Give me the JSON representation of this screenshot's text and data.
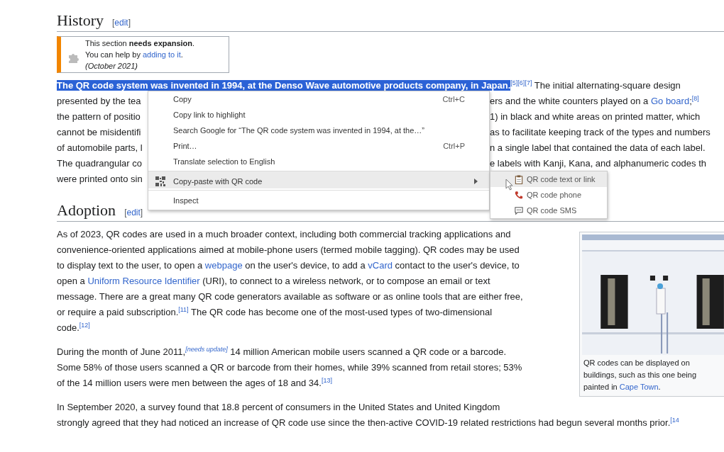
{
  "history": {
    "heading": "History",
    "edit_link": [
      "[",
      "edit",
      "]"
    ],
    "notice": {
      "lines": [
        [
          {
            "kind": "text",
            "text": "This section "
          },
          {
            "kind": "bold",
            "text": "needs expansion"
          },
          {
            "kind": "text",
            "text": "."
          }
        ],
        [
          {
            "kind": "text",
            "text": "You can help by "
          },
          {
            "kind": "link",
            "text": "adding to it"
          },
          {
            "kind": "text",
            "text": "."
          }
        ],
        [
          {
            "kind": "italic",
            "text": "(October 2021)"
          }
        ]
      ]
    },
    "paragraph": [
      {
        "left": [
          {
            "kind": "selected",
            "text": "The QR code system was invented in 1994, at the Denso Wave automotive products company, in Japan."
          },
          {
            "kind": "ref",
            "text": "[5]"
          },
          {
            "kind": "ref",
            "text": "[6]"
          },
          {
            "kind": "ref",
            "text": "[7]"
          },
          {
            "kind": "text",
            "text": " The initial alternating-square design"
          }
        ]
      },
      {
        "left": [
          {
            "kind": "text",
            "text": "presented by the tea"
          }
        ],
        "right": [
          {
            "kind": "text",
            "text": "ers and the white counters played on a "
          },
          {
            "kind": "link",
            "text": "Go board"
          },
          {
            "kind": "text",
            "text": ";"
          },
          {
            "kind": "ref",
            "text": "[8]"
          }
        ]
      },
      {
        "left": [
          {
            "kind": "text",
            "text": "the pattern of positio"
          }
        ],
        "right": [
          {
            "kind": "text",
            "text": "1) in black and white areas on printed matter, which"
          }
        ]
      },
      {
        "left": [
          {
            "kind": "text",
            "text": "cannot be misidentifi"
          }
        ],
        "right": [
          {
            "kind": "text",
            "text": "as to facilitate keeping track of the types and numbers"
          }
        ]
      },
      {
        "left": [
          {
            "kind": "text",
            "text": "of automobile parts, l"
          }
        ],
        "right": [
          {
            "kind": "text",
            "text": "n a single label that contained the data of each label."
          }
        ]
      },
      {
        "left": [
          {
            "kind": "text",
            "text": "The quadrangular co"
          }
        ],
        "right": [
          {
            "kind": "text",
            "text": "e labels with Kanji, Kana, and alphanumeric codes th"
          }
        ]
      },
      {
        "left": [
          {
            "kind": "text",
            "text": "were printed onto sin"
          }
        ]
      }
    ]
  },
  "context_menu": {
    "items": [
      {
        "label": "Copy",
        "shortcut": "Ctrl+C",
        "selected": false,
        "separator_before": false,
        "submenu": false
      },
      {
        "label": "Copy link to highlight",
        "selected": false,
        "separator_before": false,
        "submenu": false
      },
      {
        "label": "Search Google for “The QR code system was invented in 1994, at the…”",
        "selected": false,
        "separator_before": false,
        "submenu": false
      },
      {
        "label": "Print…",
        "shortcut": "Ctrl+P",
        "selected": false,
        "separator_before": false,
        "submenu": false
      },
      {
        "label": "Translate selection to English",
        "selected": false,
        "separator_before": false,
        "submenu": false
      },
      {
        "label": "Copy-paste with QR code",
        "selected": true,
        "separator_before": true,
        "submenu": true
      },
      {
        "label": "Inspect",
        "selected": false,
        "separator_before": true,
        "submenu": false
      }
    ],
    "submenu": [
      {
        "label": "QR code text or link",
        "selected": true
      },
      {
        "label": "QR code phone",
        "selected": false
      },
      {
        "label": "QR code SMS",
        "selected": false
      }
    ]
  },
  "adoption": {
    "heading": "Adoption",
    "edit_link": [
      "[",
      "edit",
      "]"
    ],
    "figure": {
      "kind": "picture",
      "caption": [
        [
          {
            "kind": "text",
            "text": "QR codes can be displayed on"
          }
        ],
        [
          {
            "kind": "text",
            "text": "buildings, such as this one being"
          }
        ],
        [
          {
            "kind": "text",
            "text": "painted in "
          },
          {
            "kind": "link",
            "text": "Cape Town"
          },
          {
            "kind": "text",
            "text": "."
          }
        ]
      ]
    },
    "paragraphs": [
      [
        [
          {
            "kind": "text",
            "text": "As of 2023, QR codes are used in a much broader context, including both commercial tracking applications and"
          }
        ],
        [
          {
            "kind": "text",
            "text": "convenience-oriented applications aimed at mobile-phone users (termed mobile tagging). QR codes may be used"
          }
        ],
        [
          {
            "kind": "text",
            "text": "to display text to the user, to open a "
          },
          {
            "kind": "link",
            "text": "webpage"
          },
          {
            "kind": "text",
            "text": " on the user's device, to add a "
          },
          {
            "kind": "link",
            "text": "vCard"
          },
          {
            "kind": "text",
            "text": " contact to the user's device, to"
          }
        ],
        [
          {
            "kind": "text",
            "text": "open a "
          },
          {
            "kind": "link",
            "text": "Uniform Resource Identifier"
          },
          {
            "kind": "text",
            "text": " (URI), to connect to a wireless network, or to compose an email or text"
          }
        ],
        [
          {
            "kind": "text",
            "text": "message. There are a great many QR code generators available as software or as online tools that are either free,"
          }
        ],
        [
          {
            "kind": "text",
            "text": "or require a paid subscription."
          },
          {
            "kind": "ref",
            "text": "[11]"
          },
          {
            "kind": "text",
            "text": " The QR code has become one of the most-used types of two-dimensional"
          }
        ],
        [
          {
            "kind": "text",
            "text": "code."
          },
          {
            "kind": "ref",
            "text": "[12]"
          }
        ]
      ],
      [
        [
          {
            "kind": "text",
            "text": "During the month of June 2011,"
          },
          {
            "kind": "ref-italic",
            "text": "[needs update]"
          },
          {
            "kind": "text",
            "text": " 14 million American mobile users scanned a QR code or a barcode."
          }
        ],
        [
          {
            "kind": "text",
            "text": "Some 58% of those users scanned a QR or barcode from their homes, while 39% scanned from retail stores; 53%"
          }
        ],
        [
          {
            "kind": "text",
            "text": "of the 14 million users were men between the ages of 18 and 34."
          },
          {
            "kind": "ref",
            "text": "[13]"
          }
        ]
      ],
      [
        [
          {
            "kind": "text",
            "text": "In September 2020, a survey found that 18.8 percent of consumers in the United States and United Kingdom"
          }
        ],
        [
          {
            "kind": "text",
            "text": "strongly agreed that they had noticed an increase of QR code use since the then-active COVID-19 related restrictions had begun several months prior."
          },
          {
            "kind": "ref",
            "text": "[14"
          }
        ]
      ]
    ]
  }
}
